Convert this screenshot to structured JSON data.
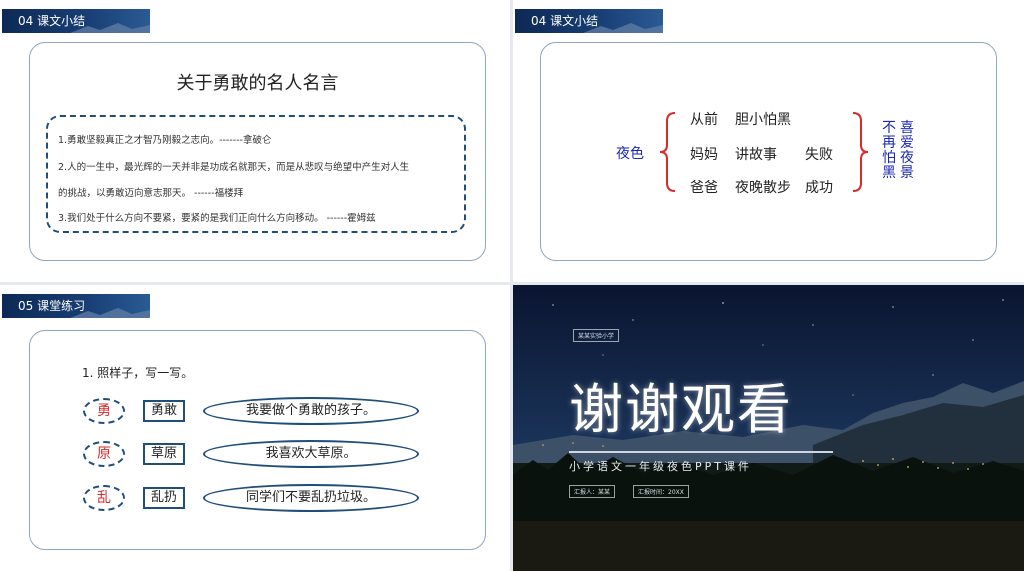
{
  "slide1": {
    "tag": "04  课文小结",
    "title": "关于勇敢的名人名言",
    "quotes": [
      "1.勇敢坚毅真正之才智乃刚毅之志向。-------拿破仑",
      "2.人的一生中，最光辉的一天并非是功成名就那天，而是从悲叹与绝望中产生对人生",
      "的挑战，以勇敢迈向意志那天。 ------福楼拜",
      "3.我们处于什么方向不要紧，要紧的是我们正向什么方向移动。 ------霍姆兹"
    ]
  },
  "slide2": {
    "tag": "04  课文小结",
    "left": "夜色",
    "rows": [
      [
        "从前",
        "胆小怕黑",
        ""
      ],
      [
        "妈妈",
        "讲故事",
        "失败"
      ],
      [
        "爸爸",
        "夜晚散步",
        "成功"
      ]
    ],
    "right_col1": [
      "不",
      "再",
      "怕",
      "黑"
    ],
    "right_col2": [
      "喜",
      "爱",
      "夜",
      "景"
    ],
    "colors": {
      "bracket": "#d62b2b",
      "blue_text": "#1a27b5"
    }
  },
  "slide3": {
    "tag": "05  课堂练习",
    "question": "1. 照样子，写一写。",
    "items": [
      {
        "char": "勇",
        "word": "勇敢",
        "sentence": "我要做个勇敢的孩子。"
      },
      {
        "char": "原",
        "word": "草原",
        "sentence": "我喜欢大草原。"
      },
      {
        "char": "乱",
        "word": "乱扔",
        "sentence": "同学们不要乱扔垃圾。"
      }
    ]
  },
  "slide4": {
    "school": "某某实验小学",
    "title": "谢谢观看",
    "subtitle": "小学语文一年级夜色PPT课件",
    "reporter": "汇报人：某某",
    "time": "汇报时间：20XX"
  }
}
